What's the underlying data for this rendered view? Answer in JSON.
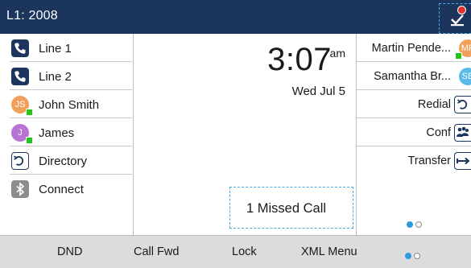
{
  "header": {
    "line_label": "L1: 2008",
    "voicemail_icon": "voicemail-check-icon"
  },
  "left_keys": [
    {
      "label": "Line 1",
      "icon": "phone-icon"
    },
    {
      "label": "Line 2",
      "icon": "phone-icon"
    },
    {
      "label": "John Smith",
      "avatar_initials": "JS",
      "avatar_color": "#f0a05a",
      "presence_color": "#25c418"
    },
    {
      "label": "James",
      "avatar_initials": "J",
      "avatar_color": "#b874d4",
      "presence_color": "#25c418"
    },
    {
      "label": "Directory",
      "icon": "directory-icon"
    },
    {
      "label": "Connect",
      "icon": "bluetooth-icon"
    }
  ],
  "clock": {
    "time": "3:07",
    "ampm": "am",
    "date": "Wed Jul 5"
  },
  "missed_calls": "1  Missed Call",
  "right_keys": [
    {
      "label": "Martin Pende...",
      "avatar_initials": "MP",
      "avatar_color": "#f0a05a",
      "presence_color": "#25c418"
    },
    {
      "label": "Samantha Br...",
      "avatar_initials": "SB",
      "avatar_color": "#5bbbe8"
    },
    {
      "label": "Redial",
      "icon": "redial-icon"
    },
    {
      "label": "Conf",
      "icon": "conference-icon"
    },
    {
      "label": "Transfer",
      "icon": "transfer-icon"
    }
  ],
  "right_pagination": {
    "current": 1,
    "total": 2
  },
  "softkeys": [
    "DND",
    "Call Fwd",
    "Lock",
    "XML Menu"
  ],
  "softkey_pagination": {
    "current": 1,
    "total": 2
  },
  "colors": {
    "header_bg": "#1b355c",
    "accent": "#2d9be0",
    "focus_outline": "#4aa8e0",
    "presence_available": "#25c418",
    "voicemail_badge": "#e0322c"
  }
}
